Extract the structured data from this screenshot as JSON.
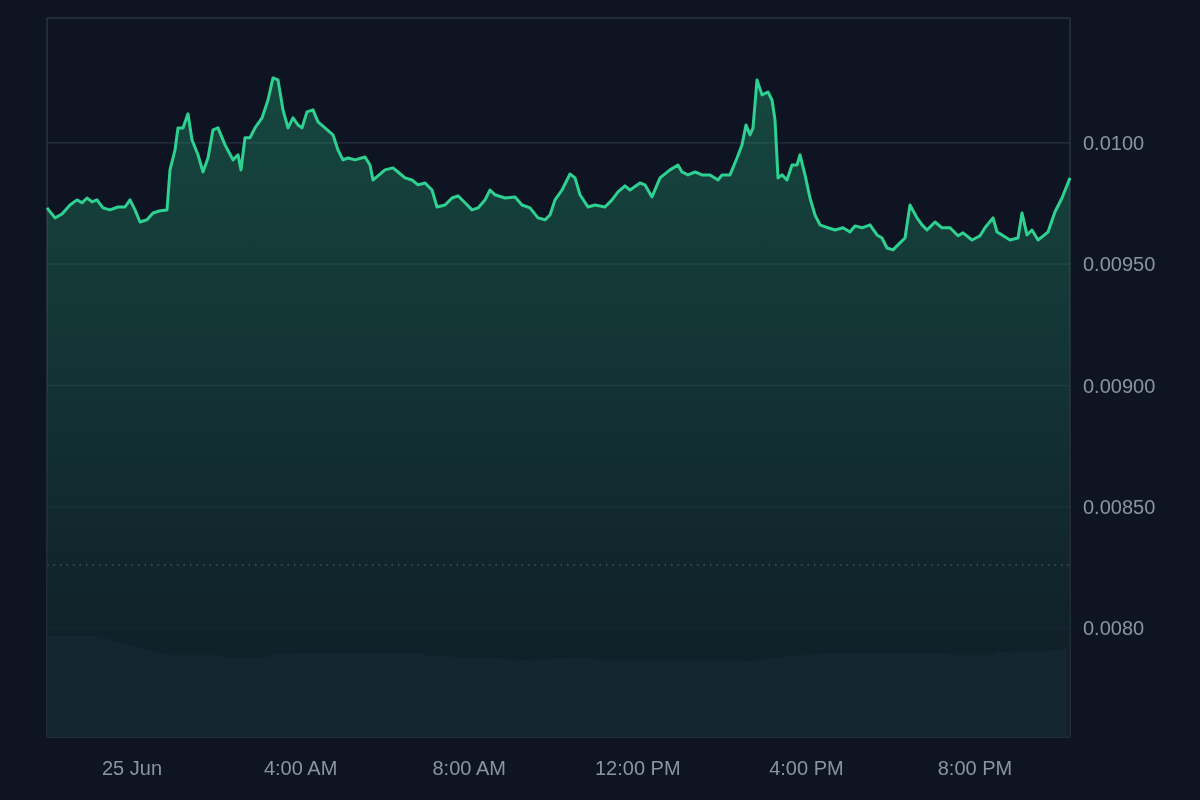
{
  "chart": {
    "chart_data": {
      "type": "area",
      "x": [
        -2.017,
        -1.827,
        -1.661,
        -1.471,
        -1.305,
        -1.186,
        -1.068,
        -0.949,
        -0.83,
        -0.688,
        -0.522,
        -0.332,
        -0.166,
        -0.047,
        0.071,
        0.19,
        0.356,
        0.498,
        0.664,
        0.83,
        0.902,
        1.02,
        1.091,
        1.21,
        1.329,
        1.423,
        1.566,
        1.684,
        1.803,
        1.922,
        2.04,
        2.206,
        2.396,
        2.515,
        2.586,
        2.681,
        2.8,
        2.918,
        3.084,
        3.227,
        3.345,
        3.464,
        3.583,
        3.701,
        3.82,
        3.938,
        4.033,
        4.152,
        4.294,
        4.413,
        4.579,
        4.769,
        4.887,
        5.006,
        5.125,
        5.291,
        5.528,
        5.647,
        5.718,
        5.836,
        6.002,
        6.192,
        6.311,
        6.477,
        6.643,
        6.785,
        6.951,
        7.117,
        7.236,
        7.426,
        7.592,
        7.734,
        7.9,
        8.066,
        8.209,
        8.375,
        8.493,
        8.612,
        8.849,
        9.087,
        9.253,
        9.442,
        9.632,
        9.798,
        9.917,
        10.036,
        10.202,
        10.391,
        10.51,
        10.629,
        10.819,
        10.985,
        11.222,
        11.388,
        11.53,
        11.696,
        11.815,
        12.053,
        12.171,
        12.337,
        12.527,
        12.764,
        12.954,
        13.049,
        13.191,
        13.357,
        13.523,
        13.713,
        13.903,
        13.998,
        14.187,
        14.353,
        14.472,
        14.567,
        14.662,
        14.733,
        14.828,
        14.947,
        15.089,
        15.184,
        15.255,
        15.326,
        15.421,
        15.54,
        15.658,
        15.777,
        15.848,
        15.967,
        16.085,
        16.204,
        16.323,
        16.512,
        16.679,
        16.868,
        17.034,
        17.153,
        17.319,
        17.509,
        17.675,
        17.794,
        17.912,
        18.055,
        18.221,
        18.339,
        18.458,
        18.624,
        18.743,
        18.861,
        19.051,
        19.217,
        19.407,
        19.597,
        19.715,
        19.929,
        20.119,
        20.237,
        20.427,
        20.522,
        20.641,
        20.83,
        21.02,
        21.115,
        21.234,
        21.352,
        21.495,
        21.59,
        21.732,
        21.898,
        22.064,
        22.254
      ],
      "series": [
        {
          "type": "area",
          "color": "#2ed191",
          "values": [
            0.009732,
            0.009691,
            0.009707,
            0.009744,
            0.009765,
            0.009753,
            0.009773,
            0.009757,
            0.009765,
            0.009732,
            0.009724,
            0.009736,
            0.009736,
            0.009765,
            0.009724,
            0.009674,
            0.009683,
            0.009711,
            0.00972,
            0.009724,
            0.009889,
            0.009971,
            0.010062,
            0.010062,
            0.01012,
            0.010012,
            0.009951,
            0.00988,
            0.009938,
            0.010054,
            0.010062,
            0.009992,
            0.00993,
            0.009951,
            0.009889,
            0.010021,
            0.010021,
            0.010062,
            0.010103,
            0.010177,
            0.010268,
            0.01026,
            0.010136,
            0.010062,
            0.010103,
            0.010074,
            0.010062,
            0.010128,
            0.010136,
            0.010087,
            0.010062,
            0.010033,
            0.009971,
            0.00993,
            0.009938,
            0.00993,
            0.009942,
            0.009909,
            0.009847,
            0.009864,
            0.009889,
            0.009897,
            0.00988,
            0.009856,
            0.009847,
            0.009827,
            0.009835,
            0.009806,
            0.009736,
            0.009744,
            0.009773,
            0.009782,
            0.009753,
            0.009724,
            0.009732,
            0.009765,
            0.009806,
            0.009786,
            0.009773,
            0.009777,
            0.009744,
            0.009732,
            0.009691,
            0.009683,
            0.009703,
            0.009765,
            0.009806,
            0.009872,
            0.009856,
            0.009786,
            0.009736,
            0.009744,
            0.009736,
            0.009765,
            0.009798,
            0.009823,
            0.009806,
            0.009835,
            0.009827,
            0.009777,
            0.009856,
            0.009889,
            0.009909,
            0.00988,
            0.009868,
            0.00988,
            0.009868,
            0.009868,
            0.009847,
            0.009868,
            0.009868,
            0.009938,
            0.009992,
            0.010074,
            0.010033,
            0.010062,
            0.01026,
            0.010198,
            0.01021,
            0.010177,
            0.010095,
            0.009856,
            0.009868,
            0.009847,
            0.009909,
            0.009909,
            0.009951,
            0.009868,
            0.009773,
            0.009703,
            0.009662,
            0.00965,
            0.009641,
            0.00965,
            0.009633,
            0.009658,
            0.00965,
            0.009662,
            0.009621,
            0.009608,
            0.009567,
            0.009559,
            0.009588,
            0.009608,
            0.009744,
            0.009691,
            0.009662,
            0.009641,
            0.009674,
            0.00965,
            0.00965,
            0.009617,
            0.009629,
            0.0096,
            0.009617,
            0.00965,
            0.009691,
            0.009633,
            0.009621,
            0.0096,
            0.009608,
            0.009711,
            0.009621,
            0.009641,
            0.0096,
            0.009613,
            0.009633,
            0.009716,
            0.009773,
            0.009856
          ]
        }
      ],
      "grid": true,
      "xlim": [
        -2.017,
        22.254
      ],
      "ylim": [
        0.007551,
        0.010515
      ],
      "xticks": [
        {
          "value": 0,
          "label": "25 Jun"
        },
        {
          "value": 4,
          "label": "4:00 AM"
        },
        {
          "value": 8,
          "label": "8:00 AM"
        },
        {
          "value": 12,
          "label": "12:00 PM"
        },
        {
          "value": 16,
          "label": "4:00 PM"
        },
        {
          "value": 20,
          "label": "8:00 PM"
        }
      ],
      "yticks": [
        {
          "value": 0.01,
          "label": "0.0100"
        },
        {
          "value": 0.0095,
          "label": "0.00950"
        },
        {
          "value": 0.009,
          "label": "0.00900"
        },
        {
          "value": 0.0085,
          "label": "0.00850"
        },
        {
          "value": 0.008,
          "label": "0.0080"
        }
      ]
    }
  }
}
